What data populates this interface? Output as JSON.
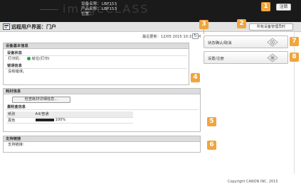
{
  "header": {
    "brand": "imageCLASS",
    "device_name_label": "设备名称：",
    "device_name_value": "LBP153",
    "product_name_label": "产品名称：",
    "product_name_value": "LBP153",
    "location_label": "位置：",
    "logout_label": "注销"
  },
  "titlebar": {
    "title": "远程用户界面：门户",
    "help_label": "所有设备管理员时"
  },
  "status_line": {
    "last_updated": "最近更新：12/05 2015 10:15 AM"
  },
  "device_status": {
    "header": "设备基本信息",
    "status_header": "设备状态",
    "printer_label": "打印机：",
    "printer_status": "就位(打印)",
    "error_header": "错误信息",
    "error_line": "没有错误。"
  },
  "consumables": {
    "header": "耗材信息",
    "button_label": "检查耗材详细信息...",
    "paper_header": "墨粉盒信息",
    "paper_col": "纸张",
    "paper_value": "A4/普通",
    "toner_color": "黑色",
    "toner_level": "100%"
  },
  "support": {
    "header": "支持链接",
    "line": "支持链接："
  },
  "nav": {
    "status_monitor": "状态确认/取消",
    "settings": "设置/注册"
  },
  "footer": {
    "copyright": "Copyright CANON INC. 2015"
  },
  "callouts": [
    "1",
    "2",
    "3",
    "4",
    "5",
    "6",
    "7",
    "8"
  ],
  "colors": {
    "callout": "#f0a53d",
    "header_bg": "#1a1a1a",
    "status_dot": "#2aa33a"
  }
}
